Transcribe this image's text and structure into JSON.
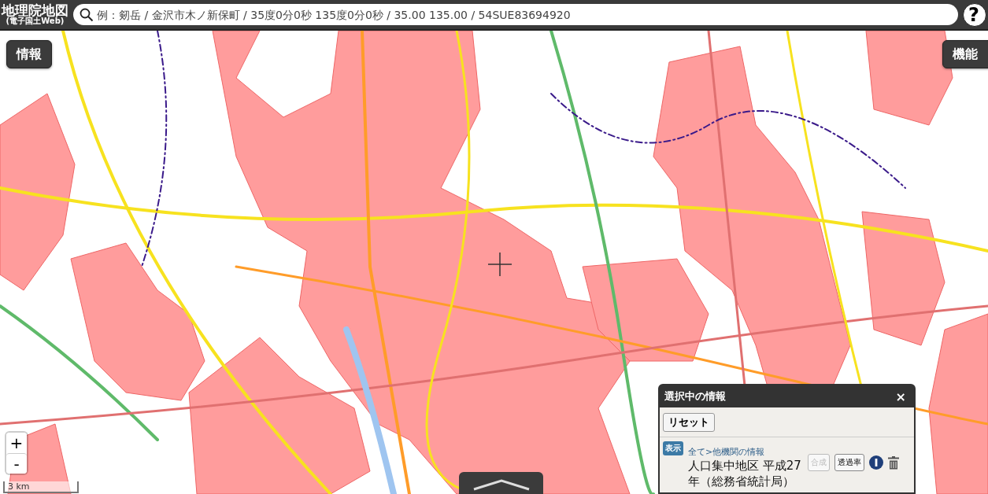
{
  "header": {
    "logo_title": "地理院地図",
    "logo_subtitle": "(電子国土Web)",
    "search": {
      "placeholder": "例：剱岳 / 金沢市木ノ新保町 / 35度0分0秒 135度0分0秒 / 35.00 135.00 / 54SUE83694920"
    },
    "help_button": "?"
  },
  "map": {
    "info_button": "情報",
    "function_button": "機能",
    "zoom_in": "+",
    "zoom_out": "-",
    "scale": "3 km"
  },
  "panel": {
    "title": "選択中の情報",
    "close": "×",
    "reset_button": "リセット",
    "layers": [
      {
        "badge": "表示",
        "path": "全て>他機関の情報",
        "name": "人口集中地区 平成27年（総務省統計局）",
        "buttons": [
          {
            "label": "合成",
            "disabled": true
          },
          {
            "label": "透過率",
            "disabled": false
          }
        ]
      }
    ]
  }
}
